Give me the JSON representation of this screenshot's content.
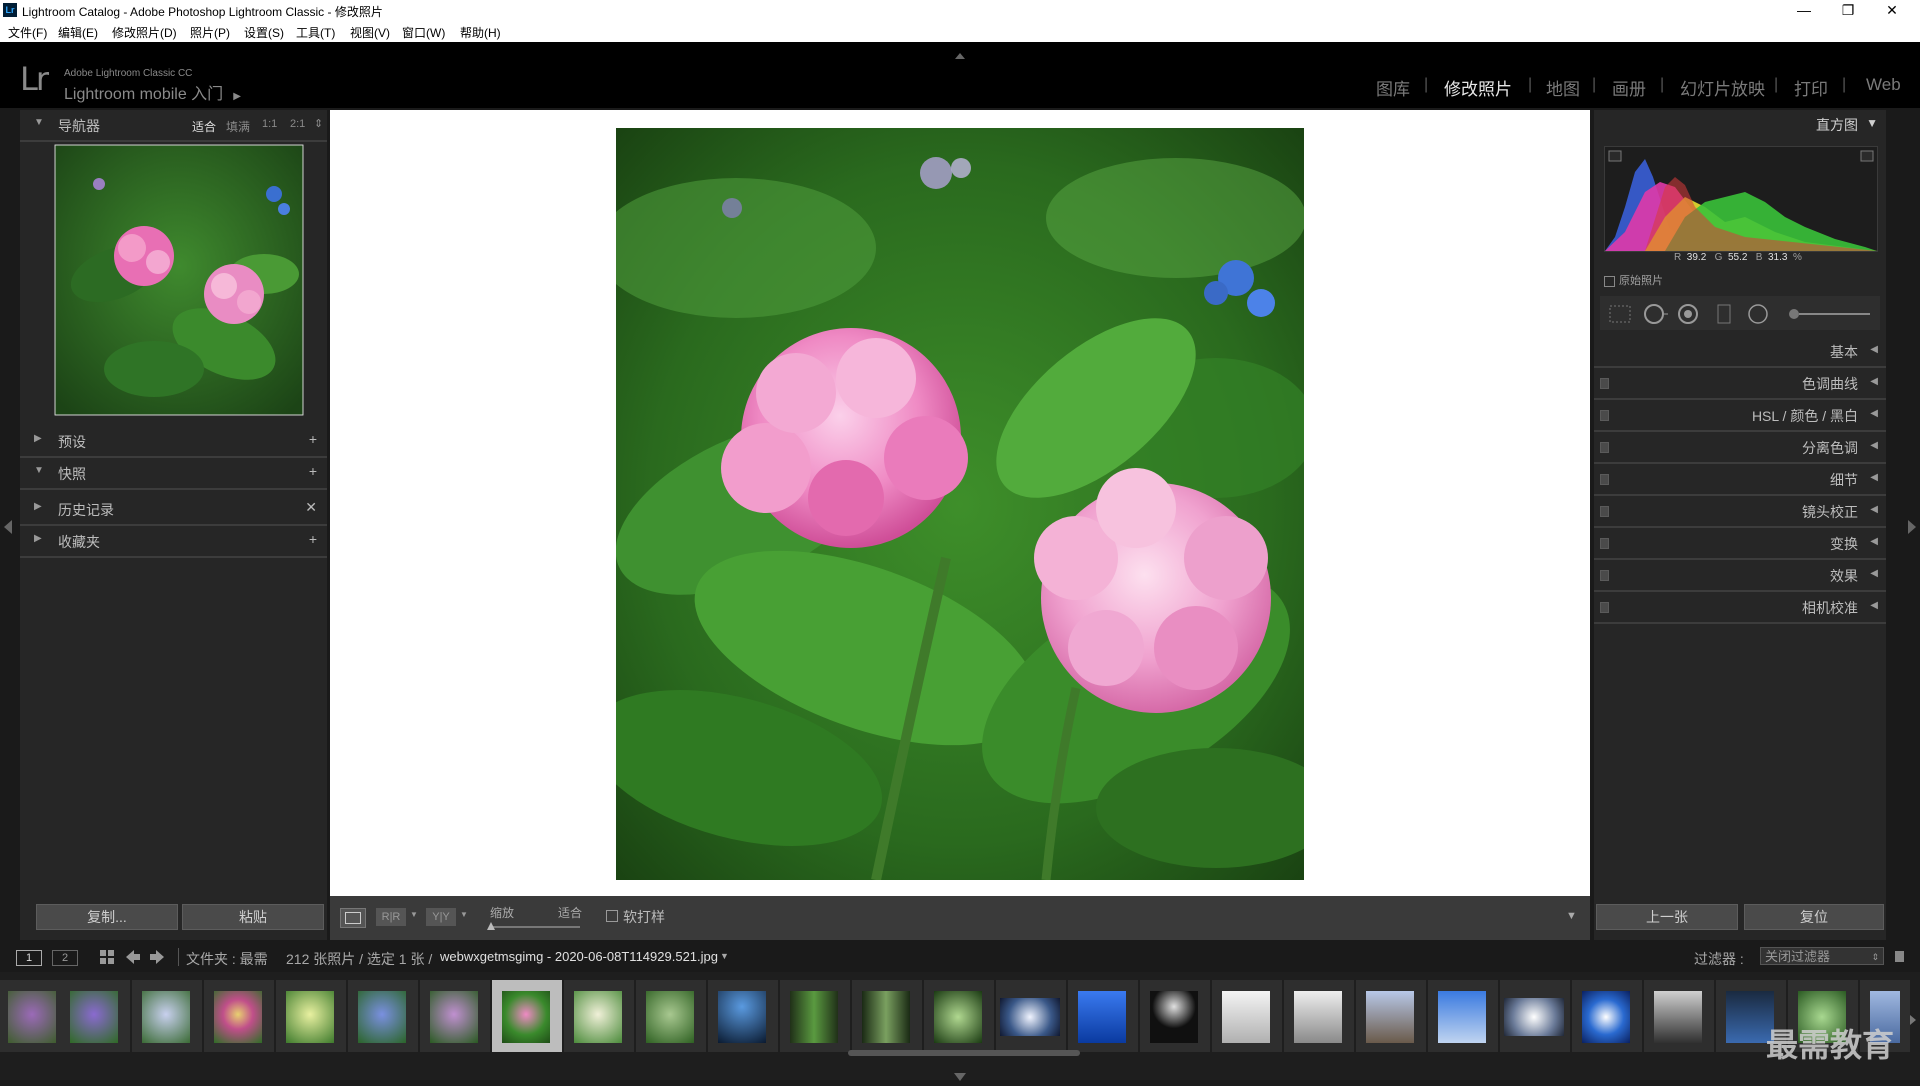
{
  "window": {
    "title": "Lightroom Catalog - Adobe Photoshop Lightroom Classic - 修改照片",
    "app_icon": "Lr",
    "controls": [
      "—",
      "❐",
      "✕"
    ]
  },
  "menu": [
    "文件(F)",
    "编辑(E)",
    "修改照片(D)",
    "照片(P)",
    "设置(S)",
    "工具(T)",
    "视图(V)",
    "窗口(W)",
    "帮助(H)"
  ],
  "identity": {
    "logo": "Lr",
    "line1": "Adobe Lightroom Classic CC",
    "line2": "Lightroom mobile 入门",
    "arrow": "▶"
  },
  "modules": [
    "图库",
    "修改照片",
    "地图",
    "画册",
    "幻灯片放映",
    "打印",
    "Web"
  ],
  "active_module": "修改照片",
  "left_panel": {
    "navigator": {
      "title": "导航器",
      "zoom_options": [
        "适合",
        "填满",
        "1:1",
        "2:1"
      ],
      "active_zoom": "适合",
      "zoom_menu_glyph": "⇕"
    },
    "sections": [
      {
        "label": "预设",
        "tri": "▶",
        "action": "+"
      },
      {
        "label": "快照",
        "tri": "▼",
        "action": "+"
      },
      {
        "label": "历史记录",
        "tri": "▶",
        "action": "✕"
      },
      {
        "label": "收藏夹",
        "tri": "▶",
        "action": "+"
      }
    ],
    "copy_button": "复制...",
    "paste_button": "粘贴"
  },
  "right_panel": {
    "histogram_title": "直方图",
    "histogram_tri": "▼",
    "rgb": {
      "r_label": "R",
      "r": "39.2",
      "g_label": "G",
      "g": "55.2",
      "b_label": "B",
      "b": "31.3",
      "unit": "%"
    },
    "original_photo_label": "原始照片",
    "sections": [
      {
        "label": "基本",
        "switch": false
      },
      {
        "label": "色调曲线",
        "switch": true
      },
      {
        "label": "HSL / 颜色 / 黑白",
        "switch": true
      },
      {
        "label": "分离色调",
        "switch": true
      },
      {
        "label": "细节",
        "switch": true
      },
      {
        "label": "镜头校正",
        "switch": true
      },
      {
        "label": "变换",
        "switch": true
      },
      {
        "label": "效果",
        "switch": true
      },
      {
        "label": "相机校准",
        "switch": true
      }
    ],
    "section_tri": "◀",
    "prev_button": "上一张",
    "reset_button": "复位"
  },
  "toolbar": {
    "compare_glyph": "R|R",
    "before_after_glyph": "Y|Y",
    "zoom_label": "缩放",
    "fit_label": "适合",
    "soft_proof_label": "软打样",
    "menu_glyph": "▼"
  },
  "filmstrip": {
    "view_buttons": [
      "1",
      "2"
    ],
    "source_text": "文件夹 : 最需",
    "count_text": "212 张照片 / 选定 1 张 /",
    "filename": "webwxgetmsgimg - 2020-06-08T114929.521.jpg",
    "filename_caret": "▼",
    "filter_label": "过滤器 :",
    "filter_value": "关闭过滤器",
    "selected_index": 7
  },
  "watermark": "最需教育",
  "colors": {
    "background": "#1a1a1a",
    "panel": "#262626",
    "active_text": "#e6e6e6",
    "inactive_text": "#7a7a7a"
  }
}
